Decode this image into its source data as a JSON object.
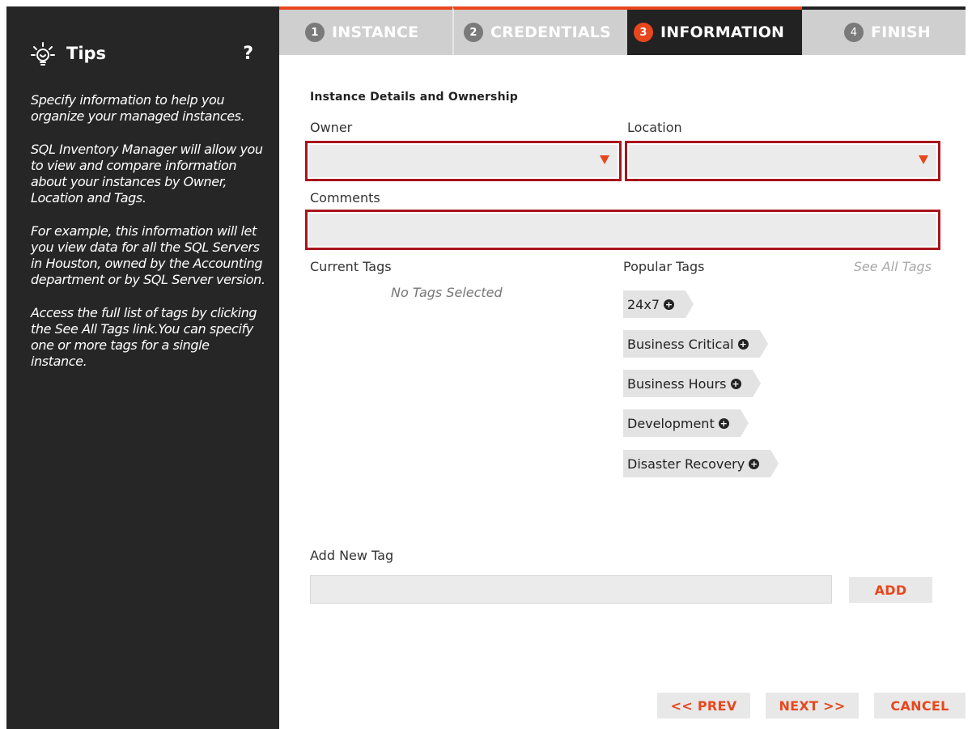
{
  "sidebar": {
    "title": "Tips",
    "help_label": "?",
    "icon": "lightbulb-icon",
    "paragraphs": [
      "Specify information to help you organize your managed instances.",
      "SQL Inventory Manager will allow you to view and compare information about your instances by Owner, Location and Tags.",
      "For example, this information will let you view data for all the SQL Servers in Houston, owned by the Accounting department or by SQL Server version.",
      "Access the full list of tags by clicking the See All Tags link.You can specify one or more tags for a single instance."
    ]
  },
  "tabs": [
    {
      "num": "1",
      "label": "INSTANCE",
      "active": false
    },
    {
      "num": "2",
      "label": "CREDENTIALS",
      "active": false
    },
    {
      "num": "3",
      "label": "INFORMATION",
      "active": true
    },
    {
      "num": "4",
      "label": "FINISH",
      "active": false
    }
  ],
  "form": {
    "section_title": "Instance Details and Ownership",
    "owner_label": "Owner",
    "owner_value": "",
    "location_label": "Location",
    "location_value": "",
    "comments_label": "Comments",
    "comments_value": "",
    "current_tags_label": "Current Tags",
    "no_tags_text": "No Tags Selected",
    "popular_tags_label": "Popular Tags",
    "see_all_label": "See All Tags",
    "popular_tags": [
      "24x7",
      "Business Critical",
      "Business Hours",
      "Development",
      "Disaster Recovery"
    ],
    "add_new_tag_label": "Add New Tag",
    "add_new_tag_value": "",
    "add_button": "ADD"
  },
  "footer": {
    "prev": "<< PREV",
    "next": "NEXT >>",
    "cancel": "CANCEL"
  },
  "colors": {
    "accent": "#e8471e",
    "error_border": "#a8141b",
    "sidebar_bg": "#262626",
    "tab_bg": "#cfcfcf"
  }
}
